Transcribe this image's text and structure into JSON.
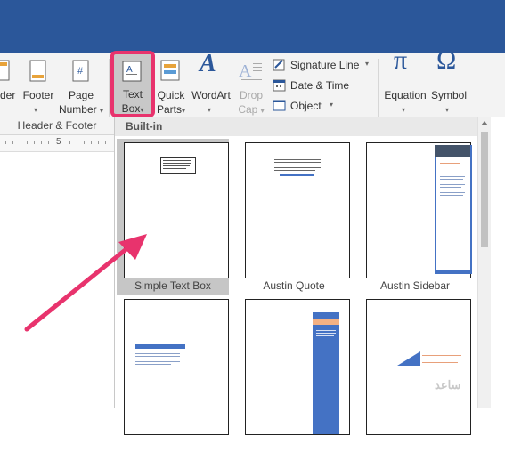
{
  "ribbon": {
    "header_label_top": "",
    "header_label_bottom": "der",
    "footer_label": "Footer",
    "footer_arrow": "▾",
    "page_number_label_top": "Page",
    "page_number_label_bottom": "Number",
    "page_number_arrow": "▾",
    "text_box_label_top": "Text",
    "text_box_label_bottom": "Box",
    "text_box_arrow": "▾",
    "quick_parts_top": "Quick",
    "quick_parts_bottom": "Parts",
    "quick_parts_arrow": "▾",
    "wordart_label": "WordArt",
    "wordart_arrow": "▾",
    "drop_cap_top": "Drop",
    "drop_cap_bottom": "Cap",
    "drop_cap_arrow": "▾",
    "signature_line_label": "Signature Line",
    "signature_line_arrow": "▾",
    "date_time_label": "Date & Time",
    "object_label": "Object",
    "object_arrow": "▾",
    "equation_label": "Equation",
    "equation_arrow": "▾",
    "symbol_label": "Symbol",
    "symbol_arrow": "▾",
    "header_footer_group": "Header & Footer",
    "ruler_mark": "5",
    "accent_color": "#2b579a",
    "highlight_color": "#e8336d"
  },
  "gallery": {
    "section_title": "Built-in",
    "tiles": [
      {
        "name": "Simple Text Box"
      },
      {
        "name": "Austin Quote"
      },
      {
        "name": "Austin Sidebar"
      },
      {
        "name": ""
      },
      {
        "name": ""
      },
      {
        "name": ""
      }
    ]
  },
  "watermark": {
    "text": "ﺳﺎﻋﺪ"
  }
}
